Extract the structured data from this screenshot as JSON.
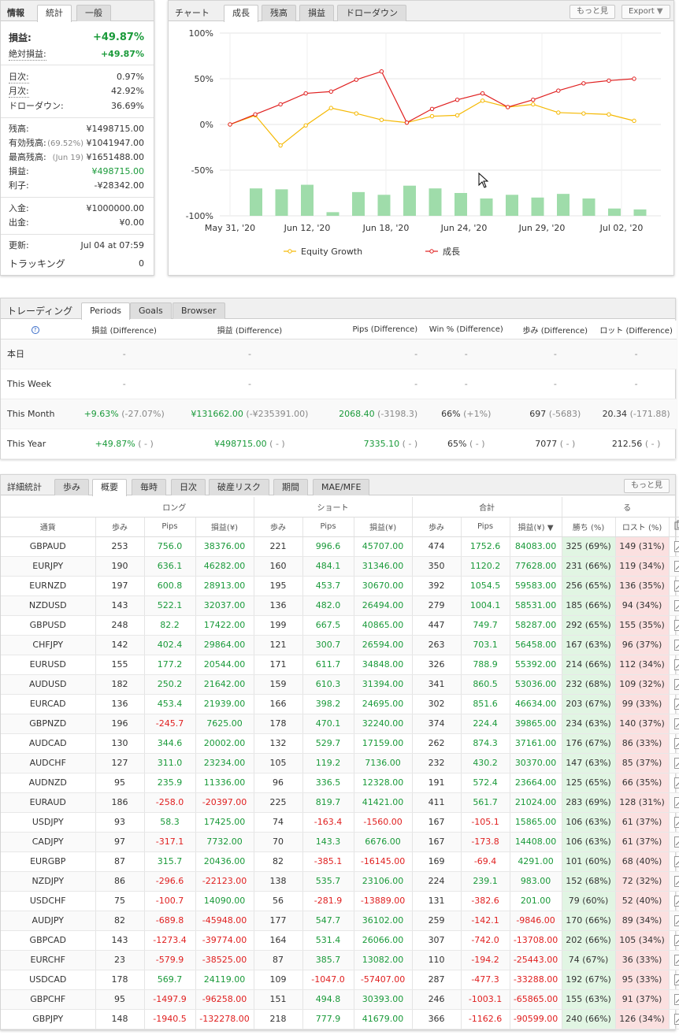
{
  "info": {
    "tabs": [
      "情報",
      "統計",
      "一般"
    ],
    "gain_label": "損益:",
    "gain_value": "+49.87%",
    "abs_gain_label": "絶対損益:",
    "abs_gain_value": "+49.87%",
    "daily_label": "日次:",
    "daily_value": "0.97%",
    "monthly_label": "月次:",
    "monthly_value": "42.92%",
    "drawdown_label": "ドローダウン:",
    "drawdown_value": "36.69%",
    "balance_label": "残高:",
    "balance_value": "¥1498715.00",
    "equity_label": "有効残高:",
    "equity_pct": "(69.52%)",
    "equity_value": "¥1041947.00",
    "highest_label": "最高残高:",
    "highest_date": "(Jun 19)",
    "highest_value": "¥1651488.00",
    "profit_label": "損益:",
    "profit_value": "¥498715.00",
    "interest_label": "利子:",
    "interest_value": "-¥28342.00",
    "deposits_label": "入金:",
    "deposits_value": "¥1000000.00",
    "withdrawals_label": "出金:",
    "withdrawals_value": "¥0.00",
    "updated_label": "更新:",
    "updated_value": "Jul 04 at 07:59",
    "tracking_label": "トラッキング",
    "tracking_value": "0"
  },
  "chart_panel": {
    "title": "チャート",
    "tabs": [
      "成長",
      "残高",
      "損益",
      "ドローダウン"
    ],
    "more_label": "もっと見",
    "export_label": "Export"
  },
  "chart_data": {
    "type": "line",
    "x": [
      "May 31, '20",
      "Jun 12, '20",
      "Jun 18, '20",
      "Jun 24, '20",
      "Jun 29, '20",
      "Jul 02, '20"
    ],
    "y_ticks": [
      "100%",
      "50%",
      "0%",
      "-50%",
      "-100%"
    ],
    "ylim": [
      -100,
      100
    ],
    "series": [
      {
        "name": "Equity Growth",
        "color": "#f5b800",
        "values": [
          0,
          10,
          -23,
          -1,
          18,
          12,
          5,
          2,
          9,
          10,
          26,
          19,
          22,
          13,
          12,
          11,
          4
        ]
      },
      {
        "name": "成長",
        "color": "#e02020",
        "values": [
          0,
          11,
          22,
          34,
          36,
          49,
          58,
          2,
          17,
          27,
          34,
          19,
          27,
          37,
          45,
          48,
          50
        ]
      }
    ],
    "bars": {
      "color": "#9fdcaa",
      "values": [
        30,
        29,
        34,
        4,
        26,
        23,
        33,
        30,
        25,
        19,
        23,
        20,
        24,
        19,
        8,
        7
      ]
    }
  },
  "trading": {
    "title": "トレーディング",
    "tabs": [
      "Periods",
      "Goals",
      "Browser"
    ],
    "help_icon": "?",
    "headers": [
      "損益 (Difference)",
      "損益 (Difference)",
      "Pips (Difference)",
      "Win % (Difference)",
      "歩み (Difference)",
      "ロット (Difference)"
    ],
    "rows": [
      {
        "label": "本日",
        "cells": [
          [
            "-",
            ""
          ],
          [
            "-",
            ""
          ],
          [
            "-",
            ""
          ],
          [
            "-",
            ""
          ],
          [
            "-",
            ""
          ],
          [
            "-",
            ""
          ]
        ]
      },
      {
        "label": "This Week",
        "cells": [
          [
            "-",
            ""
          ],
          [
            "-",
            ""
          ],
          [
            "-",
            ""
          ],
          [
            "-",
            ""
          ],
          [
            "-",
            ""
          ],
          [
            "-",
            ""
          ]
        ]
      },
      {
        "label": "This Month",
        "cells": [
          [
            "+9.63%",
            "(-27.07%)"
          ],
          [
            "¥131662.00",
            "(-¥235391.00)"
          ],
          [
            "2068.40",
            "(-3198.3)"
          ],
          [
            "66%",
            "(+1%)"
          ],
          [
            "697",
            "(-5683)"
          ],
          [
            "20.34",
            "(-171.88)"
          ]
        ]
      },
      {
        "label": "This Year",
        "cells": [
          [
            "+49.87%",
            "( - )"
          ],
          [
            "¥498715.00",
            "( - )"
          ],
          [
            "7335.10",
            "( - )"
          ],
          [
            "65%",
            "( - )"
          ],
          [
            "7077",
            "( - )"
          ],
          [
            "212.56",
            "( - )"
          ]
        ]
      }
    ]
  },
  "stats": {
    "title": "詳細統計",
    "tabs": [
      "歩み",
      "概要",
      "毎時",
      "日次",
      "破産リスク",
      "期間",
      "MAE/MFE"
    ],
    "more_label": "もっと見",
    "group_long": "ロング",
    "group_short": "ショート",
    "group_total": "合計",
    "group_extra": "る",
    "col_currency": "通貨",
    "col_trades": "歩み",
    "col_pips": "Pips",
    "col_profit": "損益(¥)",
    "col_profit_sorted": "損益(¥) ▼",
    "col_win": "勝ち (%)",
    "col_loss": "ロスト (%)",
    "rows": [
      [
        "GBPAUD",
        "253",
        "756.0",
        "38376.00",
        "221",
        "996.6",
        "45707.00",
        "474",
        "1752.6",
        "84083.00",
        "325 (69%)",
        "149 (31%)"
      ],
      [
        "EURJPY",
        "190",
        "636.1",
        "46282.00",
        "160",
        "484.1",
        "31346.00",
        "350",
        "1120.2",
        "77628.00",
        "231 (66%)",
        "119 (34%)"
      ],
      [
        "EURNZD",
        "197",
        "600.8",
        "28913.00",
        "195",
        "453.7",
        "30670.00",
        "392",
        "1054.5",
        "59583.00",
        "256 (65%)",
        "136 (35%)"
      ],
      [
        "NZDUSD",
        "143",
        "522.1",
        "32037.00",
        "136",
        "482.0",
        "26494.00",
        "279",
        "1004.1",
        "58531.00",
        "185 (66%)",
        "94 (34%)"
      ],
      [
        "GBPUSD",
        "248",
        "82.2",
        "17422.00",
        "199",
        "667.5",
        "40865.00",
        "447",
        "749.7",
        "58287.00",
        "292 (65%)",
        "155 (35%)"
      ],
      [
        "CHFJPY",
        "142",
        "402.4",
        "29864.00",
        "121",
        "300.7",
        "26594.00",
        "263",
        "703.1",
        "56458.00",
        "167 (63%)",
        "96 (37%)"
      ],
      [
        "EURUSD",
        "155",
        "177.2",
        "20544.00",
        "171",
        "611.7",
        "34848.00",
        "326",
        "788.9",
        "55392.00",
        "214 (66%)",
        "112 (34%)"
      ],
      [
        "AUDUSD",
        "182",
        "250.2",
        "21642.00",
        "159",
        "610.3",
        "31394.00",
        "341",
        "860.5",
        "53036.00",
        "232 (68%)",
        "109 (32%)"
      ],
      [
        "EURCAD",
        "136",
        "453.4",
        "21939.00",
        "166",
        "398.2",
        "24695.00",
        "302",
        "851.6",
        "46634.00",
        "203 (67%)",
        "99 (33%)"
      ],
      [
        "GBPNZD",
        "196",
        "-245.7",
        "7625.00",
        "178",
        "470.1",
        "32240.00",
        "374",
        "224.4",
        "39865.00",
        "234 (63%)",
        "140 (37%)"
      ],
      [
        "AUDCAD",
        "130",
        "344.6",
        "20002.00",
        "132",
        "529.7",
        "17159.00",
        "262",
        "874.3",
        "37161.00",
        "176 (67%)",
        "86 (33%)"
      ],
      [
        "AUDCHF",
        "127",
        "311.0",
        "23234.00",
        "105",
        "119.2",
        "7136.00",
        "232",
        "430.2",
        "30370.00",
        "147 (63%)",
        "85 (37%)"
      ],
      [
        "AUDNZD",
        "95",
        "235.9",
        "11336.00",
        "96",
        "336.5",
        "12328.00",
        "191",
        "572.4",
        "23664.00",
        "125 (65%)",
        "66 (35%)"
      ],
      [
        "EURAUD",
        "186",
        "-258.0",
        "-20397.00",
        "225",
        "819.7",
        "41421.00",
        "411",
        "561.7",
        "21024.00",
        "283 (69%)",
        "128 (31%)"
      ],
      [
        "USDJPY",
        "93",
        "58.3",
        "17425.00",
        "74",
        "-163.4",
        "-1560.00",
        "167",
        "-105.1",
        "15865.00",
        "106 (63%)",
        "61 (37%)"
      ],
      [
        "CADJPY",
        "97",
        "-317.1",
        "7732.00",
        "70",
        "143.3",
        "6676.00",
        "167",
        "-173.8",
        "14408.00",
        "106 (63%)",
        "61 (37%)"
      ],
      [
        "EURGBP",
        "87",
        "315.7",
        "20436.00",
        "82",
        "-385.1",
        "-16145.00",
        "169",
        "-69.4",
        "4291.00",
        "101 (60%)",
        "68 (40%)"
      ],
      [
        "NZDJPY",
        "86",
        "-296.6",
        "-22123.00",
        "138",
        "535.7",
        "23106.00",
        "224",
        "239.1",
        "983.00",
        "152 (68%)",
        "72 (32%)"
      ],
      [
        "USDCHF",
        "75",
        "-100.7",
        "14090.00",
        "56",
        "-281.9",
        "-13889.00",
        "131",
        "-382.6",
        "201.00",
        "79 (60%)",
        "52 (40%)"
      ],
      [
        "AUDJPY",
        "82",
        "-689.8",
        "-45948.00",
        "177",
        "547.7",
        "36102.00",
        "259",
        "-142.1",
        "-9846.00",
        "170 (66%)",
        "89 (34%)"
      ],
      [
        "GBPCAD",
        "143",
        "-1273.4",
        "-39774.00",
        "164",
        "531.4",
        "26066.00",
        "307",
        "-742.0",
        "-13708.00",
        "202 (66%)",
        "105 (34%)"
      ],
      [
        "EURCHF",
        "23",
        "-579.9",
        "-38525.00",
        "87",
        "385.7",
        "13082.00",
        "110",
        "-194.2",
        "-25443.00",
        "74 (67%)",
        "36 (33%)"
      ],
      [
        "USDCAD",
        "178",
        "569.7",
        "24119.00",
        "109",
        "-1047.0",
        "-57407.00",
        "287",
        "-477.3",
        "-33288.00",
        "192 (67%)",
        "95 (33%)"
      ],
      [
        "GBPCHF",
        "95",
        "-1497.9",
        "-96258.00",
        "151",
        "494.8",
        "30393.00",
        "246",
        "-1003.1",
        "-65865.00",
        "155 (63%)",
        "91 (37%)"
      ],
      [
        "GBPJPY",
        "148",
        "-1940.5",
        "-132278.00",
        "218",
        "777.9",
        "41679.00",
        "366",
        "-1162.6",
        "-90599.00",
        "240 (66%)",
        "126 (34%)"
      ]
    ]
  }
}
